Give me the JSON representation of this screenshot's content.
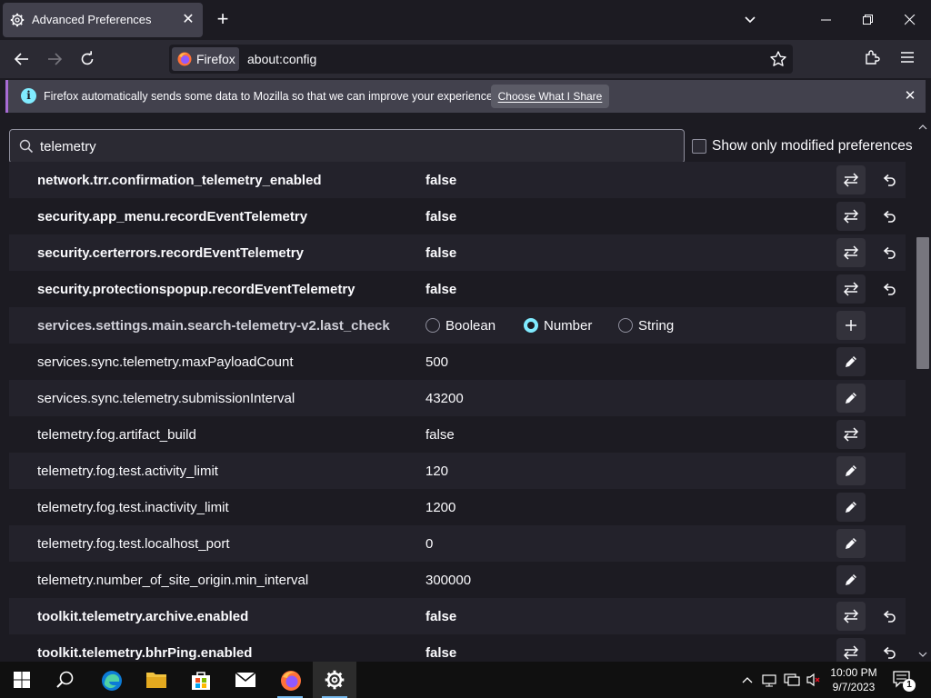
{
  "browser": {
    "tab_title": "Advanced Preferences",
    "identity_label": "Firefox",
    "url": "about:config"
  },
  "notice": {
    "text": "Firefox automatically sends some data to Mozilla so that we can improve your experience.",
    "button_label": "Choose What I Share"
  },
  "search": {
    "value": "telemetry",
    "modified_only_label": "Show only modified preferences"
  },
  "prefs": [
    {
      "name": "network.trr.confirmation_telemetry_enabled",
      "value": "false",
      "modified": true,
      "action": "toggle"
    },
    {
      "name": "security.app_menu.recordEventTelemetry",
      "value": "false",
      "modified": true,
      "action": "toggle"
    },
    {
      "name": "security.certerrors.recordEventTelemetry",
      "value": "false",
      "modified": true,
      "action": "toggle"
    },
    {
      "name": "security.protectionspopup.recordEventTelemetry",
      "value": "false",
      "modified": true,
      "action": "toggle"
    },
    {
      "name": "services.settings.main.search-telemetry-v2.last_check",
      "value": "",
      "modified": false,
      "action": "add"
    },
    {
      "name": "services.sync.telemetry.maxPayloadCount",
      "value": "500",
      "modified": false,
      "action": "edit"
    },
    {
      "name": "services.sync.telemetry.submissionInterval",
      "value": "43200",
      "modified": false,
      "action": "edit"
    },
    {
      "name": "telemetry.fog.artifact_build",
      "value": "false",
      "modified": false,
      "action": "toggle"
    },
    {
      "name": "telemetry.fog.test.activity_limit",
      "value": "120",
      "modified": false,
      "action": "edit"
    },
    {
      "name": "telemetry.fog.test.inactivity_limit",
      "value": "1200",
      "modified": false,
      "action": "edit"
    },
    {
      "name": "telemetry.fog.test.localhost_port",
      "value": "0",
      "modified": false,
      "action": "edit"
    },
    {
      "name": "telemetry.number_of_site_origin.min_interval",
      "value": "300000",
      "modified": false,
      "action": "edit"
    },
    {
      "name": "toolkit.telemetry.archive.enabled",
      "value": "false",
      "modified": true,
      "action": "toggle"
    },
    {
      "name": "toolkit.telemetry.bhrPing.enabled",
      "value": "false",
      "modified": true,
      "action": "toggle"
    }
  ],
  "new_pref_types": {
    "boolean": "Boolean",
    "number": "Number",
    "string": "String",
    "selected": "Number"
  },
  "taskbar": {
    "time": "10:00 PM",
    "date": "9/7/2023",
    "notification_count": "1"
  },
  "colors": {
    "accent": "#80ebff",
    "notice_border": "#a76bd4",
    "background": "#1c1b22"
  }
}
